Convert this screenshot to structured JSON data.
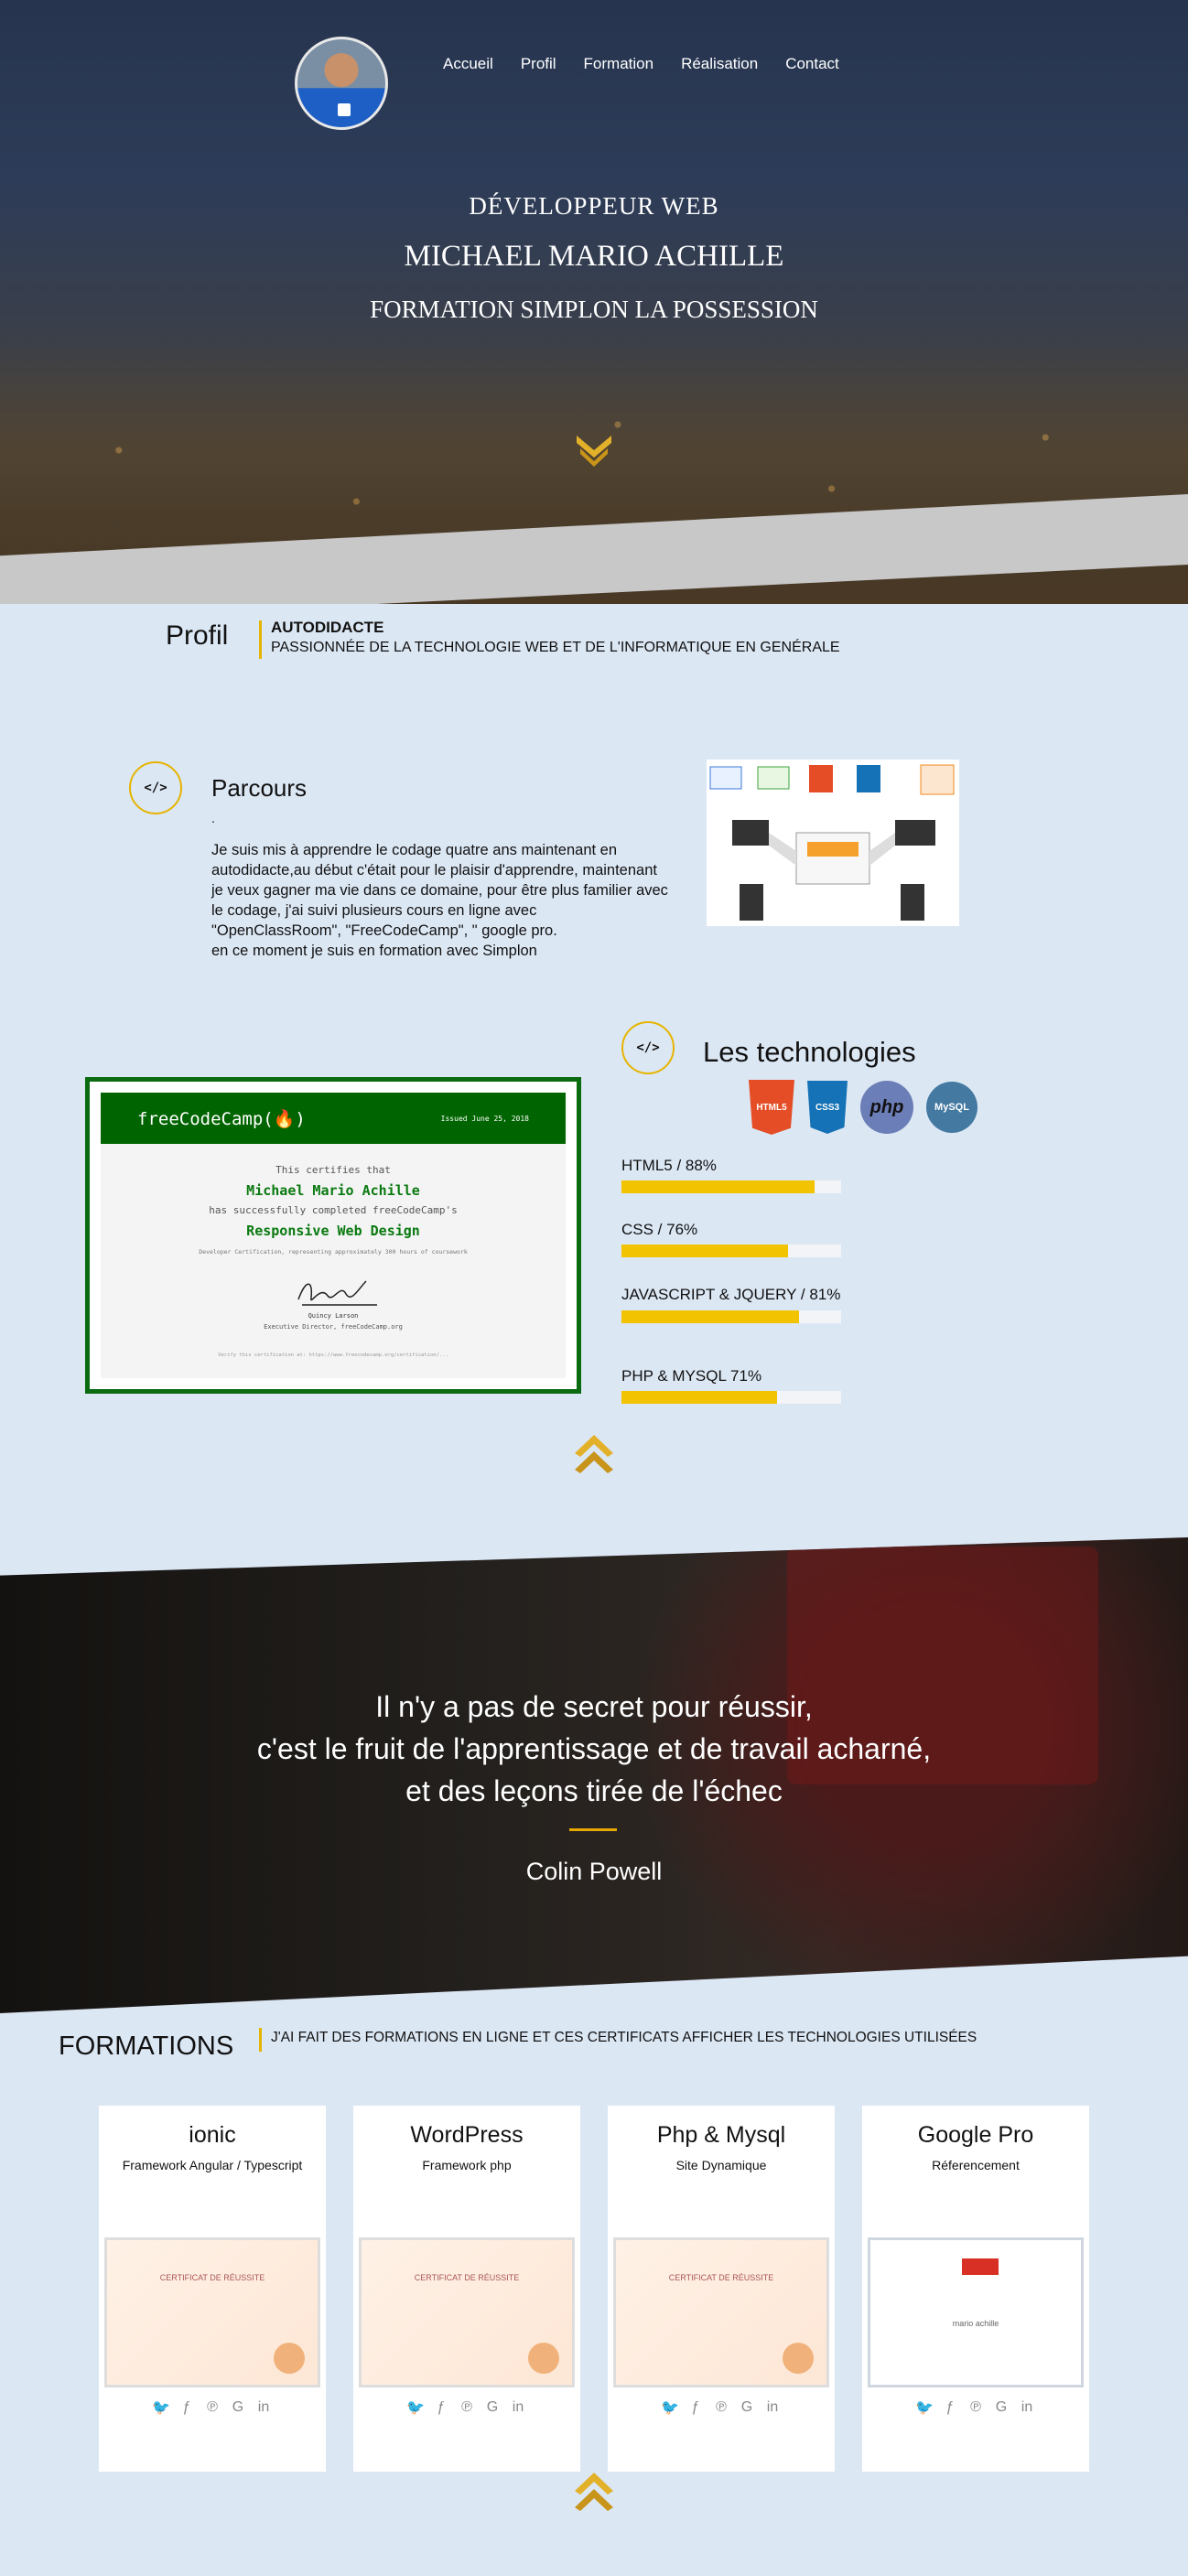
{
  "nav": {
    "items": [
      "Accueil",
      "Profil",
      "Formation",
      "Réalisation",
      "Contact"
    ]
  },
  "hero": {
    "line1": "DÉVELOPPEUR WEB",
    "line2": "MICHAEL MARIO ACHILLE",
    "line3": "FORMATION SIMPLON LA POSSESSION"
  },
  "profil": {
    "label": "Profil",
    "line1": "AUTODIDACTE",
    "line2": "PASSIONNÉE DE LA TECHNOLOGIE WEB ET DE L'INFORMATIQUE EN GENÉRALE"
  },
  "parcours": {
    "icon_text": "</>",
    "title": "Parcours",
    "dot": ".",
    "paragraph": "Je suis mis à apprendre le codage quatre ans maintenant en autodidacte,au début c'était pour le plaisir d'apprendre, maintenant je veux gagner ma vie dans ce domaine, pour être plus familier avec le codage, j'ai suivi plusieurs cours en ligne avec \"OpenClassRoom\", \"FreeCodeCamp\", \" google pro.",
    "paragraph2": "en ce moment je suis en formation avec Simplon"
  },
  "certificate": {
    "brand": "freeCodeCamp(🔥)",
    "issued": "Issued June 25, 2018",
    "certifies": "This certifies that",
    "name": "Michael Mario Achille",
    "completed": "has successfully completed freeCodeCamp's",
    "course": "Responsive Web Design",
    "hours": "Developer Certification, representing approximately 300 hours of coursework",
    "signer": "Quincy Larson",
    "role": "Executive Director, freeCodeCamp.org",
    "verify": "Verify this certification at: https://www.freecodecamp.org/certification/..."
  },
  "technologies": {
    "icon_text": "</>",
    "title": "Les technologies",
    "logos": [
      "HTML5",
      "CSS3",
      "php",
      "MySQL"
    ],
    "skills": [
      {
        "label": "HTML5 / 88%",
        "percent": 88
      },
      {
        "label": "CSS / 76%",
        "percent": 76
      },
      {
        "label": "JAVASCRIPT & JQUERY / 81%",
        "percent": 81
      },
      {
        "label": "PHP & MYSQL 71%",
        "percent": 71
      }
    ]
  },
  "quote": {
    "line1": "Il n'y a pas de secret pour réussir,",
    "line2": "c'est le fruit de l'apprentissage et de travail acharné,",
    "line3": "et des leçons tirée de l'échec",
    "author": "Colin Powell"
  },
  "formations": {
    "title": "FORMATIONS",
    "description": "J'AI FAIT DES FORMATIONS EN LIGNE ET CES CERTIFICATS AFFICHER LES TECHNOLOGIES UTILISÉES",
    "cards": [
      {
        "title": "ionic",
        "subtitle": "Framework Angular / Typescript",
        "cert_label": "CERTIFICAT DE RÉUSSITE"
      },
      {
        "title": "WordPress",
        "subtitle": "Framework php",
        "cert_label": "CERTIFICAT DE RÉUSSITE"
      },
      {
        "title": "Php & Mysql",
        "subtitle": "Site Dynamique",
        "cert_label": "CERTIFICAT DE RÉUSSITE"
      },
      {
        "title": "Google Pro",
        "subtitle": "Réferencement",
        "cert_label": "mario achille"
      }
    ]
  },
  "colors": {
    "accent": "#e6b400",
    "page_bg": "#dce7f4",
    "bar_fill": "#f2c300",
    "cert_green": "#006400"
  },
  "icons": [
    "chevron-down-icon",
    "chevron-up-icon",
    "code-icon",
    "twitter-icon",
    "facebook-icon",
    "pinterest-icon",
    "google-icon",
    "linkedin-icon"
  ]
}
